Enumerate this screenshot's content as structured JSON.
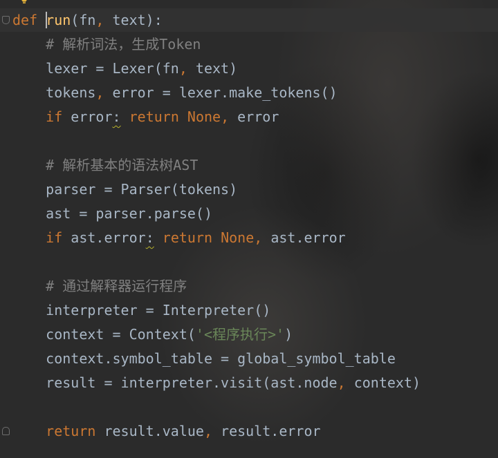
{
  "editor": {
    "lines": [
      [
        {
          "t": "def",
          "c": "kw"
        },
        {
          "t": " ",
          "c": "tx"
        },
        {
          "t": "run",
          "c": "fn"
        },
        {
          "t": "(fn",
          "c": "tx"
        },
        {
          "t": ",",
          "c": "kw"
        },
        {
          "t": " text):",
          "c": "tx"
        }
      ],
      [
        {
          "t": "    # 解析词法，生成Token",
          "c": "cm"
        }
      ],
      [
        {
          "t": "    lexer = Lexer(fn",
          "c": "tx"
        },
        {
          "t": ",",
          "c": "kw"
        },
        {
          "t": " text)",
          "c": "tx"
        }
      ],
      [
        {
          "t": "    tokens",
          "c": "tx"
        },
        {
          "t": ",",
          "c": "kw"
        },
        {
          "t": " error = lexer.make_tokens()",
          "c": "tx"
        }
      ],
      [
        {
          "t": "    ",
          "c": "tx"
        },
        {
          "t": "if",
          "c": "kw"
        },
        {
          "t": " error",
          "c": "tx"
        },
        {
          "t": ":",
          "c": "tx",
          "w": true
        },
        {
          "t": " ",
          "c": "tx"
        },
        {
          "t": "return",
          "c": "kw"
        },
        {
          "t": " ",
          "c": "tx"
        },
        {
          "t": "None,",
          "c": "kw"
        },
        {
          "t": " error",
          "c": "tx"
        }
      ],
      [],
      [
        {
          "t": "    # 解析基本的语法树AST",
          "c": "cm"
        }
      ],
      [
        {
          "t": "    parser = Parser(tokens)",
          "c": "tx"
        }
      ],
      [
        {
          "t": "    ast = parser.parse()",
          "c": "tx"
        }
      ],
      [
        {
          "t": "    ",
          "c": "tx"
        },
        {
          "t": "if",
          "c": "kw"
        },
        {
          "t": " ast.error",
          "c": "tx"
        },
        {
          "t": ":",
          "c": "tx",
          "w": true
        },
        {
          "t": " ",
          "c": "tx"
        },
        {
          "t": "return",
          "c": "kw"
        },
        {
          "t": " ",
          "c": "tx"
        },
        {
          "t": "None,",
          "c": "kw"
        },
        {
          "t": " ast.error",
          "c": "tx"
        }
      ],
      [],
      [
        {
          "t": "    # 通过解释器运行程序",
          "c": "cm"
        }
      ],
      [
        {
          "t": "    interpreter = Interpreter()",
          "c": "tx"
        }
      ],
      [
        {
          "t": "    context = Context(",
          "c": "tx"
        },
        {
          "t": "'<程序执行>'",
          "c": "str"
        },
        {
          "t": ")",
          "c": "tx"
        }
      ],
      [
        {
          "t": "    context.symbol_table = global_symbol_table",
          "c": "tx"
        }
      ],
      [
        {
          "t": "    result = interpreter.visit(ast.node",
          "c": "tx"
        },
        {
          "t": ",",
          "c": "kw"
        },
        {
          "t": " context)",
          "c": "tx"
        }
      ],
      [],
      [
        {
          "t": "    ",
          "c": "tx"
        },
        {
          "t": "return",
          "c": "kw"
        },
        {
          "t": " result.value",
          "c": "tx"
        },
        {
          "t": ",",
          "c": "kw"
        },
        {
          "t": " result.error",
          "c": "tx"
        }
      ]
    ],
    "colors": {
      "background": "#2b2b2b",
      "keyword": "#cc7832",
      "function_name": "#ffc66d",
      "comment": "#808080",
      "string": "#6a8759",
      "text": "#a9b7c6",
      "warning_underline": "#bbb529",
      "intention_bulb": "#e8b53a"
    },
    "icons": [
      "intention-bulb-icon",
      "fold-start-icon",
      "fold-end-icon"
    ],
    "caret": {
      "line": 1,
      "before_token": 2
    }
  }
}
